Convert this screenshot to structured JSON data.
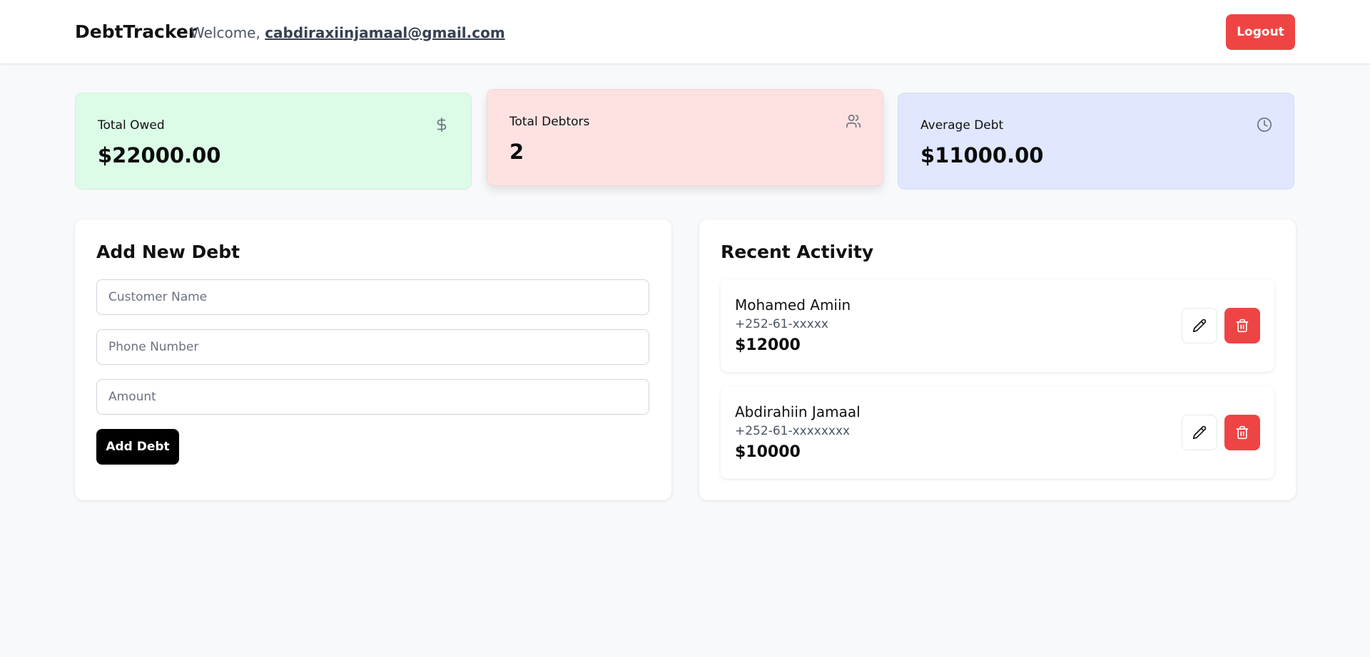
{
  "header": {
    "brand": "DebtTracker",
    "welcome_prefix": "Welcome, ",
    "user_email": "cabdiraxiinjamaal@gmail.com",
    "logout_label": "Logout"
  },
  "stats": {
    "total_owed": {
      "label": "Total Owed",
      "value": "$22000.00",
      "icon": "dollar-icon"
    },
    "total_debtors": {
      "label": "Total Debtors",
      "value": "2",
      "icon": "users-icon"
    },
    "average_debt": {
      "label": "Average Debt",
      "value": "$11000.00",
      "icon": "clock-icon"
    }
  },
  "add_debt": {
    "title": "Add New Debt",
    "customer_name_placeholder": "Customer Name",
    "phone_placeholder": "Phone Number",
    "amount_placeholder": "Amount",
    "submit_label": "Add Debt"
  },
  "recent": {
    "title": "Recent Activity",
    "items": [
      {
        "name": "Mohamed Amiin",
        "phone": "+252-61-xxxxx",
        "amount": "$12000"
      },
      {
        "name": "Abdirahiin Jamaal",
        "phone": "+252-61-xxxxxxxx",
        "amount": "$10000"
      }
    ]
  },
  "colors": {
    "accent_red": "#ef4444",
    "card_green": "#dcfce7",
    "card_red": "#fee2e2",
    "card_blue": "#e0e7ff",
    "background": "#f8f9fa"
  }
}
